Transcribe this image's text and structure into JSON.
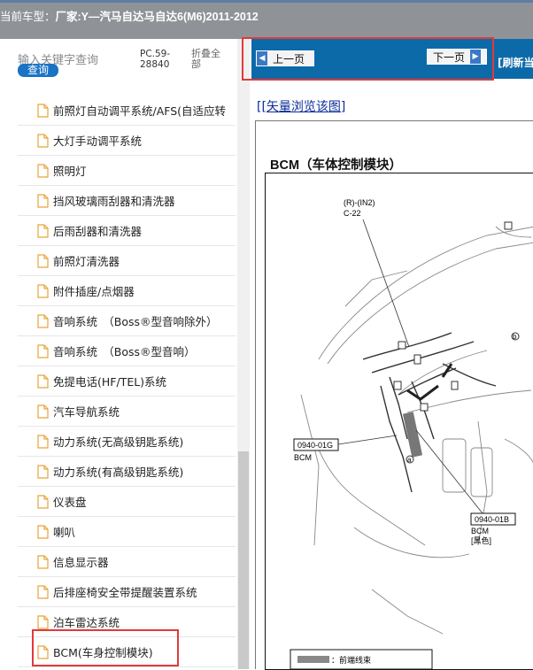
{
  "header": {
    "current_vehicle_label": "当前车型：",
    "vehicle_name": "厂家:Y—汽马自达马自达6(M6)2011-2012"
  },
  "search": {
    "keyword_placeholder": "输入关键字查询",
    "query_button": "查询",
    "code": "PC.59-28840",
    "fold_all": "折叠全部"
  },
  "tree": {
    "items": [
      {
        "label": "前照灯自动调平系统/AFS(自适应转"
      },
      {
        "label": "大灯手动调平系统"
      },
      {
        "label": "照明灯"
      },
      {
        "label": "挡风玻璃雨刮器和清洗器"
      },
      {
        "label": "后雨刮器和清洗器"
      },
      {
        "label": "前照灯清洗器"
      },
      {
        "label": "附件插座/点烟器"
      },
      {
        "label": "音响系统　（Boss®型音响除外）"
      },
      {
        "label": "音响系统　（Boss®型音响）"
      },
      {
        "label": "免提电话(HF/TEL)系统"
      },
      {
        "label": "汽车导航系统"
      },
      {
        "label": "动力系统(无高级钥匙系统)"
      },
      {
        "label": "动力系统(有高级钥匙系统)"
      },
      {
        "label": "仪表盘"
      },
      {
        "label": "喇叭"
      },
      {
        "label": "信息显示器"
      },
      {
        "label": "后排座椅安全带提醒装置系统"
      },
      {
        "label": "泊车雷达系统"
      },
      {
        "label": "BCM(车身控制模块)"
      }
    ]
  },
  "nav": {
    "prev": "上一页",
    "next": "下一页",
    "refresh": "[刷新当"
  },
  "content": {
    "vector_link": "[矢量浏览该图]",
    "bracket_open": "[",
    "doc_title": "BCM（车体控制模块）",
    "callouts": {
      "c22_line1": "(R)-(IN2)",
      "c22_line2": "C-22",
      "bcm1_code": "0940-01G",
      "bcm1_label": "BCM",
      "bcm2_code": "0940-01B",
      "bcm2_label": "BCM",
      "bcm2_sub": "[黑色]",
      "marker_b": "b",
      "marker_a": "a",
      "legend": "：前端线束"
    }
  },
  "colors": {
    "navbar": "#0d6aa9",
    "highlight": "#e03a3a",
    "query_button": "#1a73c5",
    "topbar": "#8f9397"
  }
}
